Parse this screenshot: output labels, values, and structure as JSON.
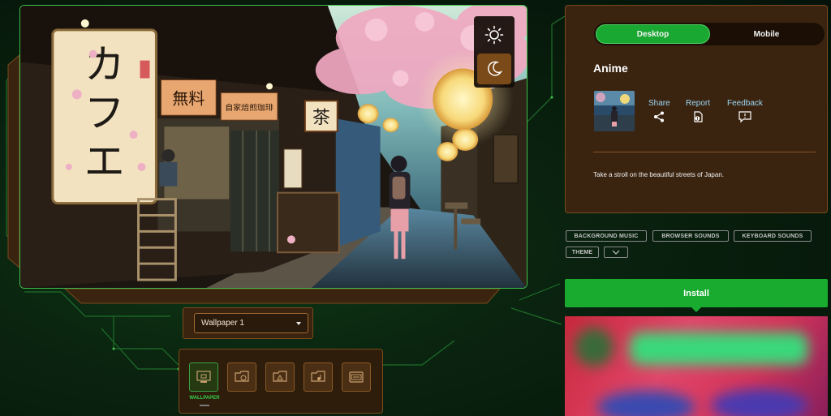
{
  "theme": {
    "active": "dark",
    "light_icon": "sun-icon",
    "dark_icon": "moon-icon"
  },
  "device_tabs": {
    "desktop_label": "Desktop",
    "mobile_label": "Mobile",
    "active": "desktop"
  },
  "theme_title": "Anime",
  "actions": {
    "share_label": "Share",
    "report_label": "Report",
    "feedback_label": "Feedback"
  },
  "description": "Take a stroll on the beautiful streets of Japan.",
  "tags": {
    "background_music": "BACKGROUND MUSIC",
    "browser_sounds": "BROWSER SOUNDS",
    "keyboard_sounds": "KEYBOARD SOUNDS",
    "theme": "THEME"
  },
  "install_label": "Install",
  "wallpaper_select": {
    "selected": "Wallpaper 1"
  },
  "tray": {
    "active_label": "WALLPAPER",
    "icons": [
      "wallpaper-icon",
      "browser-sounds-icon",
      "background-music-icon",
      "keyboard-sounds-icon",
      "theme-icon"
    ]
  },
  "scene_text": {
    "cafe_sign": "カフェ",
    "menu_sign": "無料",
    "coffee_sign": "自家焙煎珈琲",
    "tea_sign": "茶"
  },
  "colors": {
    "accent_green": "#19ab30",
    "panel_brown": "#3a2410",
    "link_blue": "#9ed6f5"
  }
}
